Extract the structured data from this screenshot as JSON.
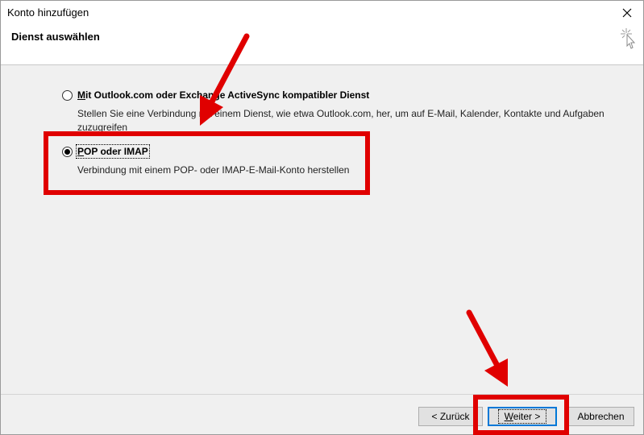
{
  "window": {
    "title": "Konto hinzufügen",
    "close_icon": "close-icon"
  },
  "header": {
    "title": "Dienst auswählen",
    "icon": "wizard-sparkle-icon"
  },
  "options": [
    {
      "label_accel": "M",
      "label_rest": "it Outlook.com oder Exchange ActiveSync kompatibler Dienst",
      "description_line1": "Stellen Sie eine Verbindung mit einem Dienst, wie etwa Outlook.com, her, um auf E-Mail, Kalender, Kontakte und Aufgaben",
      "description_line2": "zuzugreifen",
      "selected": false
    },
    {
      "label_accel": "P",
      "label_rest": "OP oder IMAP",
      "description_line1": "Verbindung mit einem POP- oder IMAP-E-Mail-Konto herstellen",
      "selected": true
    }
  ],
  "buttons": {
    "back": "< Zurück",
    "next_accel": "W",
    "next_rest": "eiter >",
    "cancel": "Abbrechen"
  },
  "colors": {
    "highlight": "#e00000",
    "default_button_border": "#0078d7"
  }
}
